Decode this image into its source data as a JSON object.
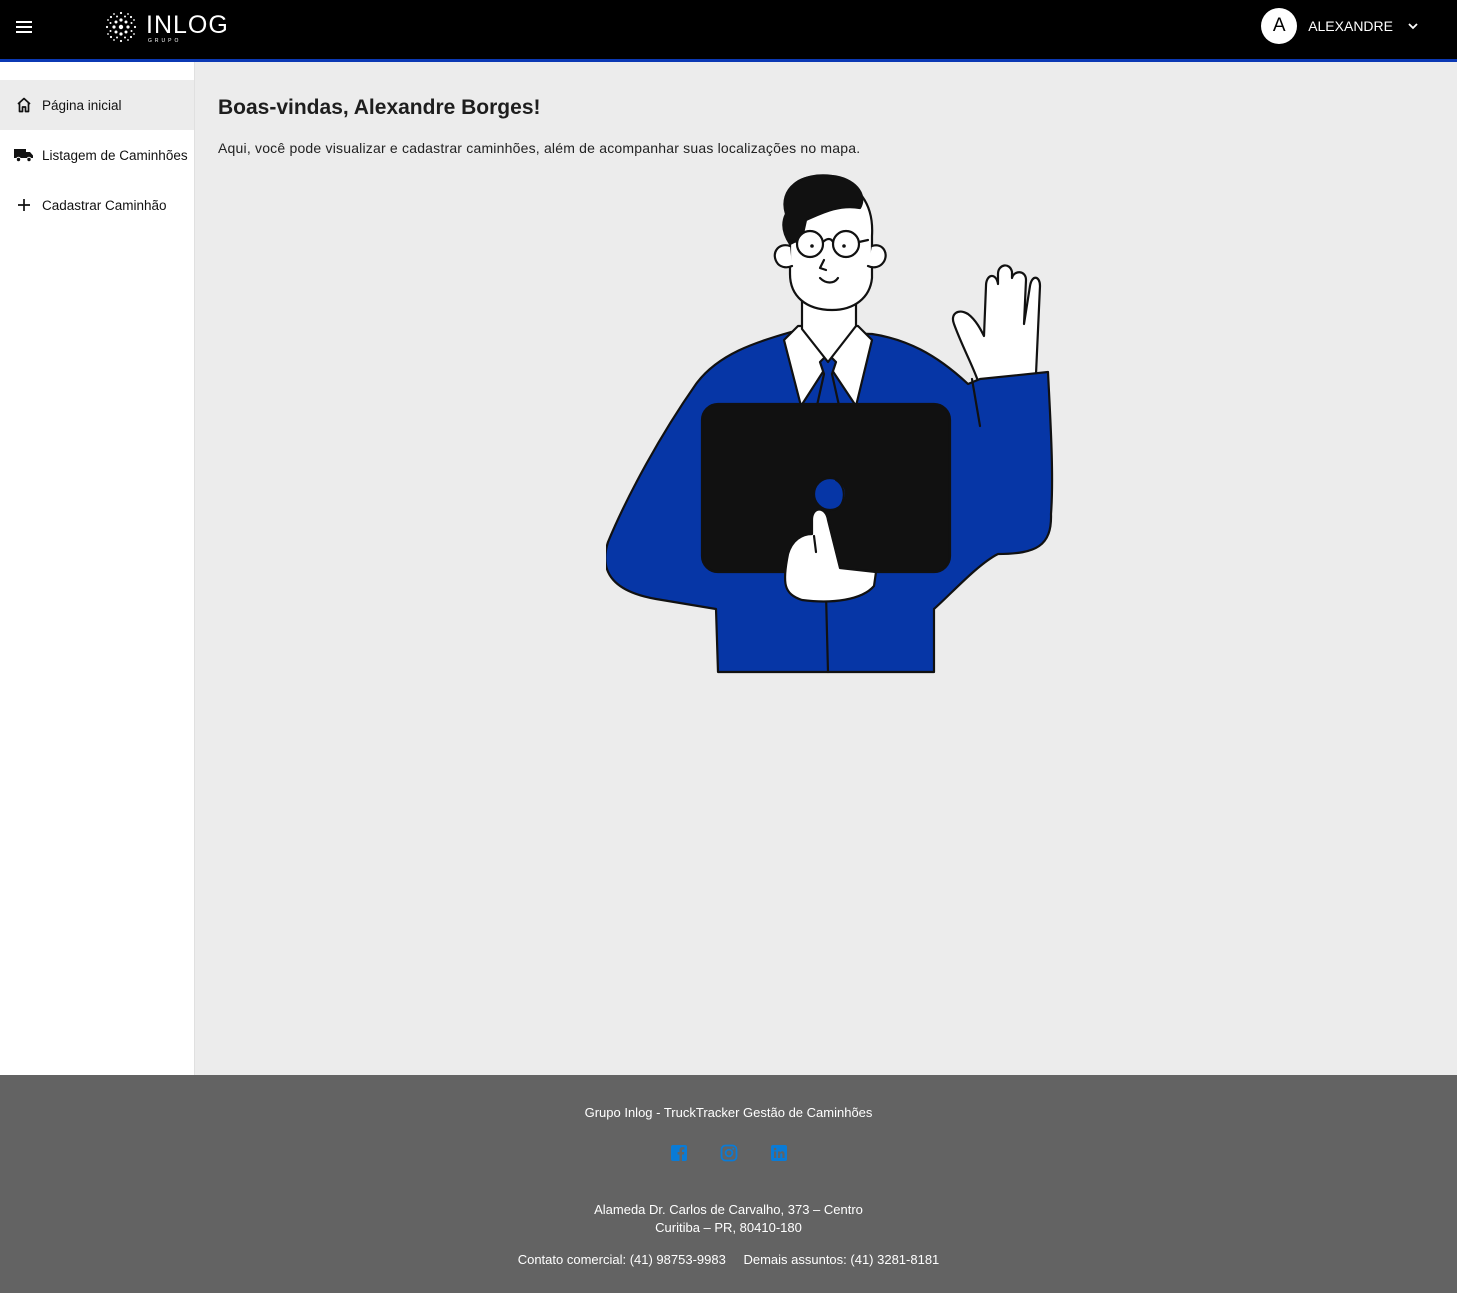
{
  "header": {
    "logo_text": "INLOG",
    "logo_sub": "GRUPO",
    "user_initial": "A",
    "user_name": "ALEXANDRE"
  },
  "sidebar": {
    "items": [
      {
        "label": "Página inicial",
        "icon": "home-icon",
        "active": true
      },
      {
        "label": "Listagem de Caminhões",
        "icon": "truck-icon",
        "active": false
      },
      {
        "label": "Cadastrar Caminhão",
        "icon": "plus-icon",
        "active": false
      }
    ]
  },
  "main": {
    "title": "Boas-vindas, Alexandre Borges!",
    "description": "Aqui, você pode visualizar e cadastrar caminhões, além de acompanhar suas localizações no mapa."
  },
  "footer": {
    "title": "Grupo Inlog - TruckTracker Gestão de Caminhões",
    "social": [
      "facebook-icon",
      "instagram-icon",
      "linkedin-icon"
    ],
    "address_line1": "Alameda Dr. Carlos de Carvalho, 373 – Centro",
    "address_line2": "Curitiba – PR, 80410-180",
    "contact_commercial": "Contato comercial: (41) 98753-9983",
    "contact_other": "Demais assuntos: (41) 3281-8181"
  },
  "colors": {
    "topbar": "#000000",
    "accent": "#0b39b4",
    "footer": "#636363",
    "social": "#0a7bd6"
  }
}
